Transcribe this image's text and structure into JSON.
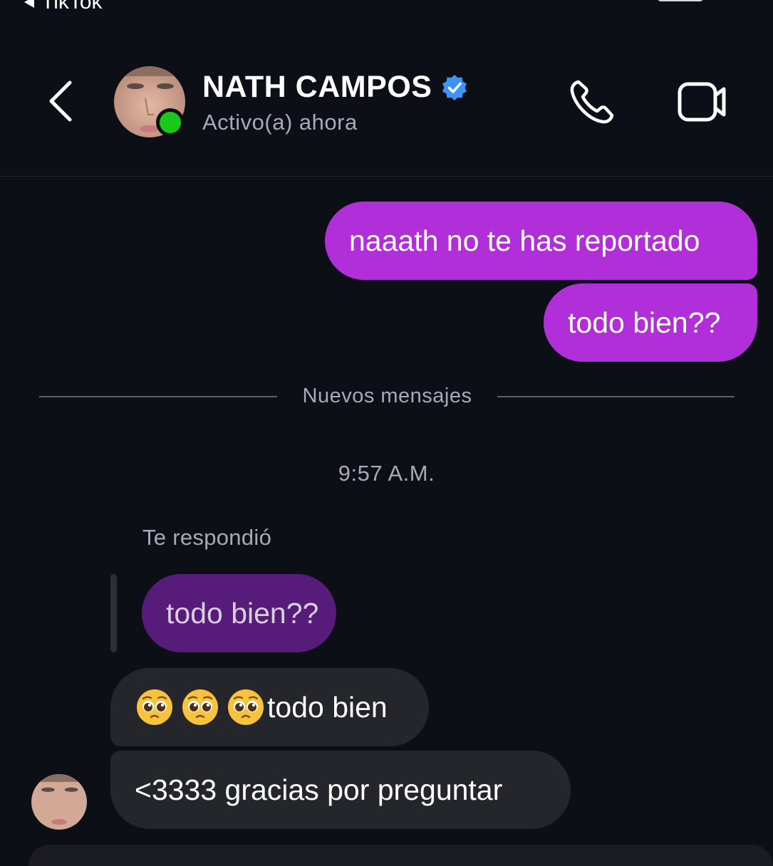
{
  "status_bar": {
    "back_label": "TikTok"
  },
  "header": {
    "name": "NATH CAMPOS",
    "status": "Activo(a) ahora",
    "verified_icon": "verified-badge-icon",
    "call_icon": "phone-icon",
    "video_icon": "video-camera-icon",
    "online_color": "#19c81a"
  },
  "messages": {
    "sent": [
      {
        "text": "naaath no te has reportado"
      },
      {
        "text": "todo bien??"
      }
    ],
    "divider": "Nuevos mensajes",
    "timestamp": "9:57 A.M.",
    "reply_label": "Te respondió",
    "quoted_text": "todo bien??",
    "received": [
      {
        "emoji": [
          "pleading-face-emoji",
          "pleading-face-emoji",
          "pleading-face-emoji"
        ],
        "text": "todo bien"
      },
      {
        "text": "<3333 gracias por preguntar"
      }
    ]
  },
  "colors": {
    "background": "#0c0f15",
    "sent_bubble": "#b12fd9",
    "quoted_bubble": "#571b7a",
    "received_bubble": "#24262b",
    "secondary_text": "#a7abb3",
    "verified_blue": "#3d94f6"
  }
}
